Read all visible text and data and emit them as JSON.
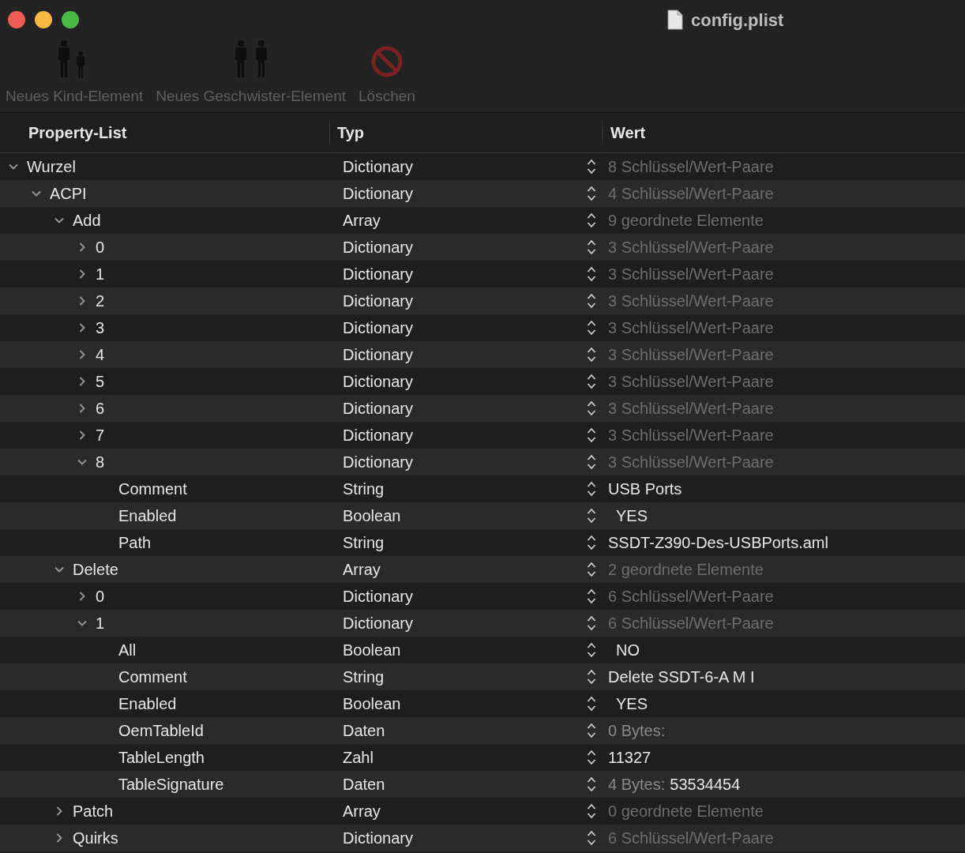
{
  "window": {
    "title": "config.plist"
  },
  "toolbar": [
    {
      "kind": "child",
      "label": "Neues Kind-Element",
      "disabled": true
    },
    {
      "kind": "sibling",
      "label": "Neues Geschwister-Element",
      "disabled": true
    },
    {
      "kind": "delete",
      "label": "Löschen",
      "disabled": true
    }
  ],
  "table": {
    "columns": [
      "Property-List",
      "Typ",
      "Wert"
    ],
    "tree": [
      {
        "key": "Wurzel",
        "type": "Dictionary",
        "value": "8 Schlüssel/Wert-Paare",
        "kind": "summary",
        "expanded": true,
        "children": [
          {
            "key": "ACPI",
            "type": "Dictionary",
            "value": "4 Schlüssel/Wert-Paare",
            "kind": "summary",
            "expanded": true,
            "children": [
              {
                "key": "Add",
                "type": "Array",
                "value": "9 geordnete Elemente",
                "kind": "summary",
                "expanded": true,
                "children": [
                  {
                    "key": "0",
                    "type": "Dictionary",
                    "value": "3 Schlüssel/Wert-Paare",
                    "kind": "summary",
                    "expanded": false
                  },
                  {
                    "key": "1",
                    "type": "Dictionary",
                    "value": "3 Schlüssel/Wert-Paare",
                    "kind": "summary",
                    "expanded": false
                  },
                  {
                    "key": "2",
                    "type": "Dictionary",
                    "value": "3 Schlüssel/Wert-Paare",
                    "kind": "summary",
                    "expanded": false
                  },
                  {
                    "key": "3",
                    "type": "Dictionary",
                    "value": "3 Schlüssel/Wert-Paare",
                    "kind": "summary",
                    "expanded": false
                  },
                  {
                    "key": "4",
                    "type": "Dictionary",
                    "value": "3 Schlüssel/Wert-Paare",
                    "kind": "summary",
                    "expanded": false
                  },
                  {
                    "key": "5",
                    "type": "Dictionary",
                    "value": "3 Schlüssel/Wert-Paare",
                    "kind": "summary",
                    "expanded": false
                  },
                  {
                    "key": "6",
                    "type": "Dictionary",
                    "value": "3 Schlüssel/Wert-Paare",
                    "kind": "summary",
                    "expanded": false
                  },
                  {
                    "key": "7",
                    "type": "Dictionary",
                    "value": "3 Schlüssel/Wert-Paare",
                    "kind": "summary",
                    "expanded": false
                  },
                  {
                    "key": "8",
                    "type": "Dictionary",
                    "value": "3 Schlüssel/Wert-Paare",
                    "kind": "summary",
                    "expanded": true,
                    "children": [
                      {
                        "key": "Comment",
                        "type": "String",
                        "value": "USB Ports",
                        "kind": "text"
                      },
                      {
                        "key": "Enabled",
                        "type": "Boolean",
                        "value": "YES",
                        "kind": "bool"
                      },
                      {
                        "key": "Path",
                        "type": "String",
                        "value": "SSDT-Z390-Des-USBPorts.aml",
                        "kind": "text"
                      }
                    ]
                  }
                ]
              },
              {
                "key": "Delete",
                "type": "Array",
                "value": "2 geordnete Elemente",
                "kind": "summary",
                "expanded": true,
                "children": [
                  {
                    "key": "0",
                    "type": "Dictionary",
                    "value": "6 Schlüssel/Wert-Paare",
                    "kind": "summary",
                    "expanded": false
                  },
                  {
                    "key": "1",
                    "type": "Dictionary",
                    "value": "6 Schlüssel/Wert-Paare",
                    "kind": "summary",
                    "expanded": true,
                    "children": [
                      {
                        "key": "All",
                        "type": "Boolean",
                        "value": "NO",
                        "kind": "bool"
                      },
                      {
                        "key": "Comment",
                        "type": "String",
                        "value": "Delete SSDT-6-A M I",
                        "kind": "text"
                      },
                      {
                        "key": "Enabled",
                        "type": "Boolean",
                        "value": "YES",
                        "kind": "bool"
                      },
                      {
                        "key": "OemTableId",
                        "type": "Daten",
                        "value": "0 Bytes:",
                        "kind": "data"
                      },
                      {
                        "key": "TableLength",
                        "type": "Zahl",
                        "value": "11327",
                        "kind": "text"
                      },
                      {
                        "key": "TableSignature",
                        "type": "Daten",
                        "value": "4 Bytes:",
                        "kind": "data",
                        "data_hex": "53534454"
                      }
                    ]
                  }
                ]
              },
              {
                "key": "Patch",
                "type": "Array",
                "value": "0 geordnete Elemente",
                "kind": "summary",
                "expanded": false
              },
              {
                "key": "Quirks",
                "type": "Dictionary",
                "value": "6 Schlüssel/Wert-Paare",
                "kind": "summary",
                "expanded": false
              }
            ]
          }
        ]
      }
    ]
  }
}
